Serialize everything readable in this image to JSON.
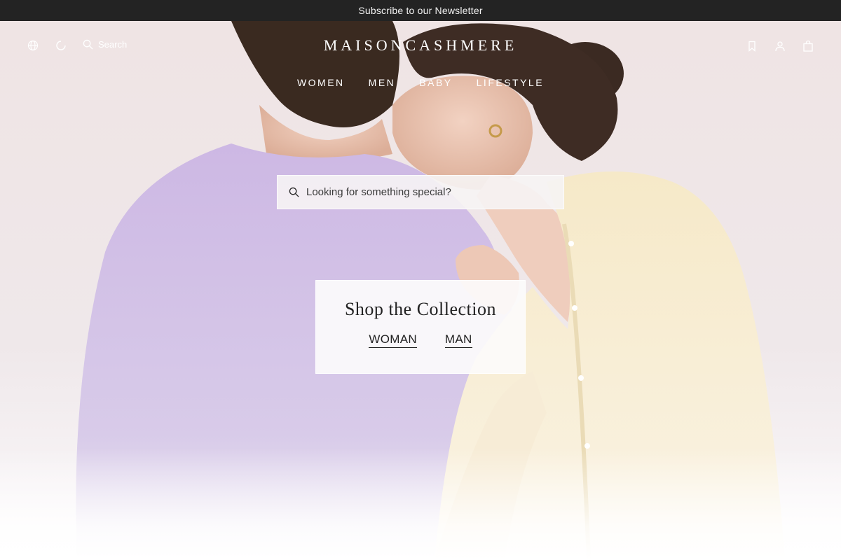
{
  "announcement": {
    "text": "Subscribe to our Newsletter"
  },
  "header": {
    "logo": "MAISONCASHMERE",
    "search_label": "Search",
    "left_icons": [
      "globe-icon",
      "loading-spinner-icon",
      "search-icon"
    ],
    "right_icons": [
      "bookmark-icon",
      "user-icon",
      "shopping-bag-icon"
    ]
  },
  "nav": {
    "items": [
      {
        "label": "WOMEN"
      },
      {
        "label": "MEN"
      },
      {
        "label": "BABY"
      },
      {
        "label": "LIFESTYLE"
      }
    ]
  },
  "hero": {
    "search_placeholder": "Looking for something special?",
    "collection": {
      "title": "Shop the Collection",
      "links": [
        {
          "label": "WOMAN"
        },
        {
          "label": "MAN"
        }
      ]
    }
  },
  "colors": {
    "announcement_bg": "#232323",
    "lavender_sweater": "#c9b8e0",
    "cream_cardigan": "#f3e6c6",
    "hero_bg": "#f1e8e8"
  }
}
